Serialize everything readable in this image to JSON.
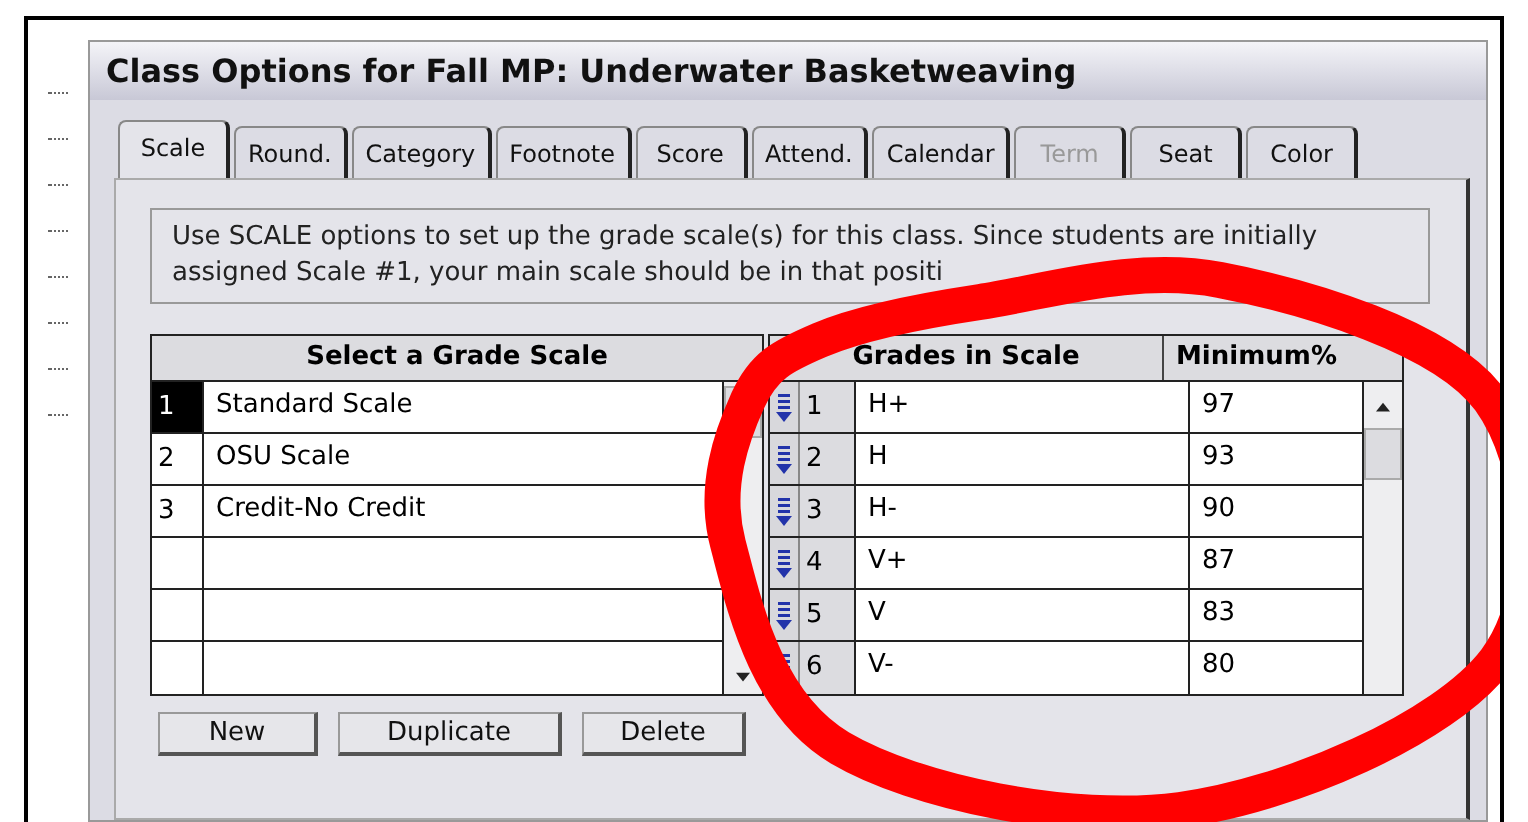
{
  "window": {
    "title": "Class Options for Fall MP: Underwater Basketweaving"
  },
  "tabs": [
    {
      "label": "Scale",
      "selected": true,
      "disabled": false
    },
    {
      "label": "Round.",
      "selected": false,
      "disabled": false
    },
    {
      "label": "Category",
      "selected": false,
      "disabled": false
    },
    {
      "label": "Footnote",
      "selected": false,
      "disabled": false
    },
    {
      "label": "Score",
      "selected": false,
      "disabled": false
    },
    {
      "label": "Attend.",
      "selected": false,
      "disabled": false
    },
    {
      "label": "Calendar",
      "selected": false,
      "disabled": false
    },
    {
      "label": "Term",
      "selected": false,
      "disabled": true
    },
    {
      "label": "Seat",
      "selected": false,
      "disabled": false
    },
    {
      "label": "Color",
      "selected": false,
      "disabled": false
    }
  ],
  "description": "Use SCALE options to set up the grade scale(s) for this class. Since students are initially assigned Scale #1, your main scale should be in that positi",
  "scales": {
    "header": "Select a Grade Scale",
    "rows": [
      {
        "number": "1",
        "name": "Standard Scale",
        "selected": true
      },
      {
        "number": "2",
        "name": "OSU Scale",
        "selected": false
      },
      {
        "number": "3",
        "name": "Credit-No Credit",
        "selected": false
      }
    ]
  },
  "grades": {
    "columns": [
      "Grades in Scale",
      "Minimum%"
    ],
    "rows": [
      {
        "number": "1",
        "grade": "H+",
        "minimum": "97"
      },
      {
        "number": "2",
        "grade": "H",
        "minimum": "93"
      },
      {
        "number": "3",
        "grade": "H-",
        "minimum": "90"
      },
      {
        "number": "4",
        "grade": "V+",
        "minimum": "87"
      },
      {
        "number": "5",
        "grade": "V",
        "minimum": "83"
      },
      {
        "number": "6",
        "grade": "V-",
        "minimum": "80"
      }
    ]
  },
  "buttons": [
    "New",
    "Duplicate",
    "Delete"
  ]
}
